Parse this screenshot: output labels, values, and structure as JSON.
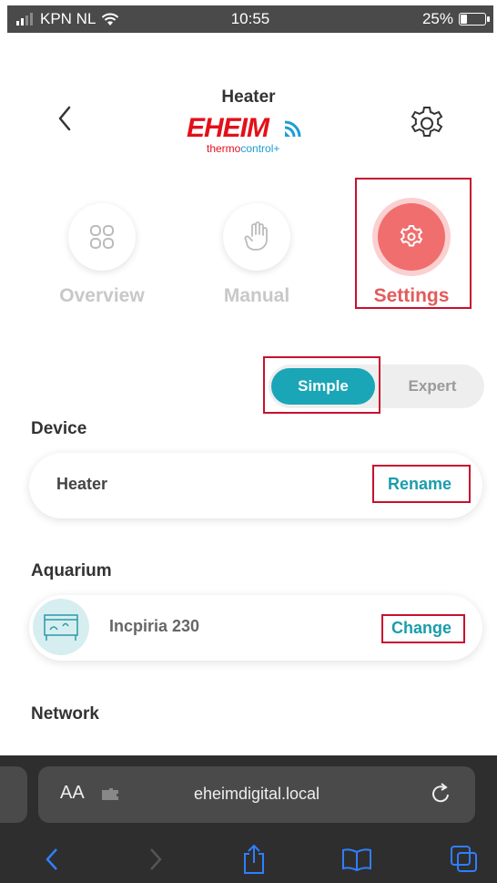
{
  "status_bar": {
    "carrier": "KPN NL",
    "time": "10:55",
    "battery": "25%",
    "battery_level": 0.25
  },
  "header": {
    "title": "Heater",
    "logo_brand": "EHEIM",
    "logo_sub_left": "thermo",
    "logo_sub_right": "control+"
  },
  "tabs": [
    {
      "label": "Overview",
      "icon": "grid-icon",
      "active": false
    },
    {
      "label": "Manual",
      "icon": "hand-icon",
      "active": false
    },
    {
      "label": "Settings",
      "icon": "gear-icon",
      "active": true
    }
  ],
  "mode_toggle": {
    "simple_label": "Simple",
    "expert_label": "Expert",
    "selected": "Simple"
  },
  "device": {
    "section_label": "Device",
    "name": "Heater",
    "action_label": "Rename"
  },
  "aquarium": {
    "section_label": "Aquarium",
    "name": "Incpiria 230",
    "action_label": "Change"
  },
  "network": {
    "section_label": "Network"
  },
  "browser": {
    "aa_label": "AA",
    "url": "eheimdigital.local"
  },
  "colors": {
    "accent": "#1aa6b7",
    "settings_active": "#f06e6e",
    "highlight_box": "#c8102e",
    "brand_red": "#e3101a"
  }
}
